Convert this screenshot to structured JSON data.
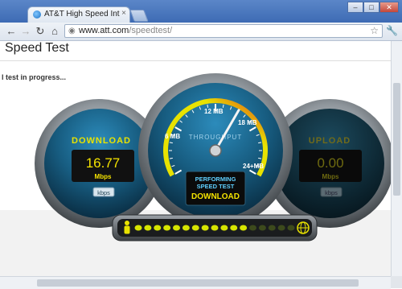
{
  "browser": {
    "tab_title": "AT&T High Speed Internet",
    "tab_close": "×",
    "url_host": "www.att.com",
    "url_path": "/speedtest/",
    "window_controls": [
      "–",
      "□",
      "✕"
    ]
  },
  "page": {
    "title": "Speed Test",
    "status": "l test in progress..."
  },
  "gauges": {
    "download": {
      "label": "DOWNLOAD",
      "value": "16.77",
      "unit": "Mbps",
      "button": "kbps"
    },
    "upload": {
      "label": "UPLOAD",
      "value": "0.00",
      "unit": "Mbps",
      "button": "kbps"
    },
    "throughput": {
      "label": "THROUGHPUT",
      "ticks": [
        "6 MB",
        "12 MB",
        "18 MB",
        "24+MB"
      ],
      "needle_value_mb": 15,
      "status_line1": "PERFORMING",
      "status_line2": "SPEED TEST",
      "status_line3": "DOWNLOAD"
    },
    "progress": {
      "lit_segments": 12,
      "total_segments": 17
    }
  },
  "colors": {
    "accent_yellow": "#e8e200",
    "panel_blue": "#1f6f9a",
    "digital_yellow": "#f4e300"
  }
}
